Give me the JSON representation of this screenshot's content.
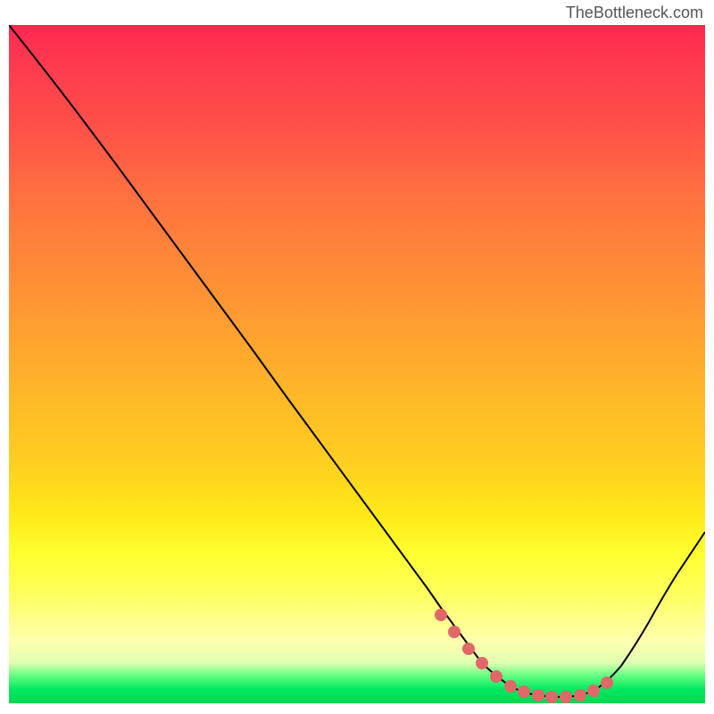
{
  "watermark": "TheBottleneck.com",
  "chart_data": {
    "type": "line",
    "title": "",
    "xlabel": "",
    "ylabel": "",
    "xlim": [
      0,
      100
    ],
    "ylim": [
      0,
      100
    ],
    "description": "Bottleneck curve showing optimal match point (minimum/valley) on red-yellow-green gradient background where green indicates optimal zone",
    "series": [
      {
        "name": "bottleneck-curve",
        "x": [
          0,
          5,
          10,
          15,
          20,
          25,
          30,
          35,
          40,
          45,
          50,
          55,
          60,
          62,
          65,
          68,
          70,
          72,
          75,
          78,
          80,
          82,
          85,
          88,
          92,
          96,
          100
        ],
        "y": [
          100,
          94,
          87,
          80,
          73,
          66,
          59,
          52,
          45,
          38,
          31,
          24,
          17,
          14,
          10,
          6,
          4,
          2.5,
          1.5,
          1,
          1,
          1.2,
          2,
          4,
          8,
          14,
          20
        ]
      }
    ],
    "highlight_region": {
      "name": "optimal-zone-markers",
      "x": [
        62,
        64,
        66,
        68,
        70,
        72,
        74,
        76,
        78,
        80,
        82,
        84,
        86
      ],
      "y": [
        13,
        10.5,
        8,
        6,
        4,
        2.5,
        1.8,
        1.2,
        1,
        1,
        1.2,
        1.8,
        3
      ]
    },
    "gradient_colors": {
      "top": "#ff2850",
      "middle": "#ffd020",
      "bottom": "#00d850"
    }
  }
}
